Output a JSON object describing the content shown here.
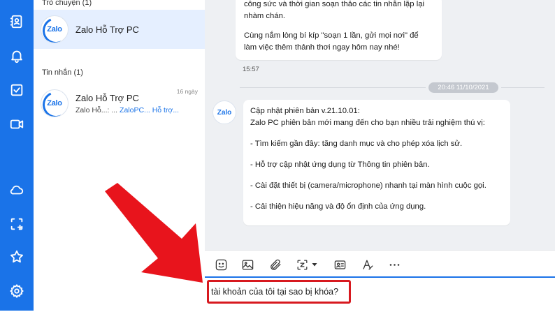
{
  "sidebar_icons": [
    {
      "name": "contacts-icon"
    },
    {
      "name": "bell-icon"
    },
    {
      "name": "todo-check-icon"
    },
    {
      "name": "video-icon"
    },
    {
      "name": "cloud-icon"
    },
    {
      "name": "screenshot-icon"
    },
    {
      "name": "star-icon"
    },
    {
      "name": "settings-icon"
    }
  ],
  "list": {
    "section1_title": "Trò chuyện (1)",
    "active_conv": {
      "avatar_text": "Zalo",
      "name": "Zalo Hỗ Trợ PC"
    },
    "section2_title": "Tin nhắn (1)",
    "msg_conv": {
      "avatar_text": "Zalo",
      "name": "Zalo Hỗ Trợ PC",
      "time": "16 ngày",
      "preview_prefix": "Zalo Hỗ...: ... ",
      "preview_highlight": "ZaloPC... Hỗ trợ..."
    }
  },
  "chat": {
    "prev_message": {
      "lines": [
        "công sức và thời gian soạn thảo các tin nhắn lặp lại",
        "nhàm chán."
      ],
      "line3": "Cùng nắm lòng bí kíp \"soạn 1 lần, gửi mọi nơi\" để",
      "line4": "làm việc thêm thảnh thơi ngay hôm nay nhé!",
      "time": "15:57"
    },
    "date_chip": "20:46 11/10/2021",
    "sender_avatar_text": "Zalo",
    "update_message": {
      "title": "Cập nhật phiên bản v.21.10.01:",
      "intro": "Zalo PC phiên bản mới mang đến cho bạn nhiều trải nghiệm thú vị:",
      "items": [
        "- Tìm kiếm gần đây: tăng danh mục và cho phép xóa lịch sử.",
        "- Hỗ trợ cập nhật ứng dụng từ Thông tin phiên bản.",
        "- Cài đặt thiết bị (camera/microphone) nhanh tại màn hình cuộc gọi.",
        "- Cải thiện hiệu năng và độ ổn định của ứng dụng."
      ]
    }
  },
  "toolbar_icons": [
    "sticker-icon",
    "image-icon",
    "attachment-icon",
    "screenshot-capture-icon",
    "chevron-down-icon",
    "contact-card-icon",
    "text-format-icon",
    "more-icon"
  ],
  "composer": {
    "value": "tài khoản của tôi tại sao bị khóa?"
  },
  "colors": {
    "accent": "#1a73e8",
    "highlight_border": "#d7191f",
    "arrow": "#e8141c"
  }
}
